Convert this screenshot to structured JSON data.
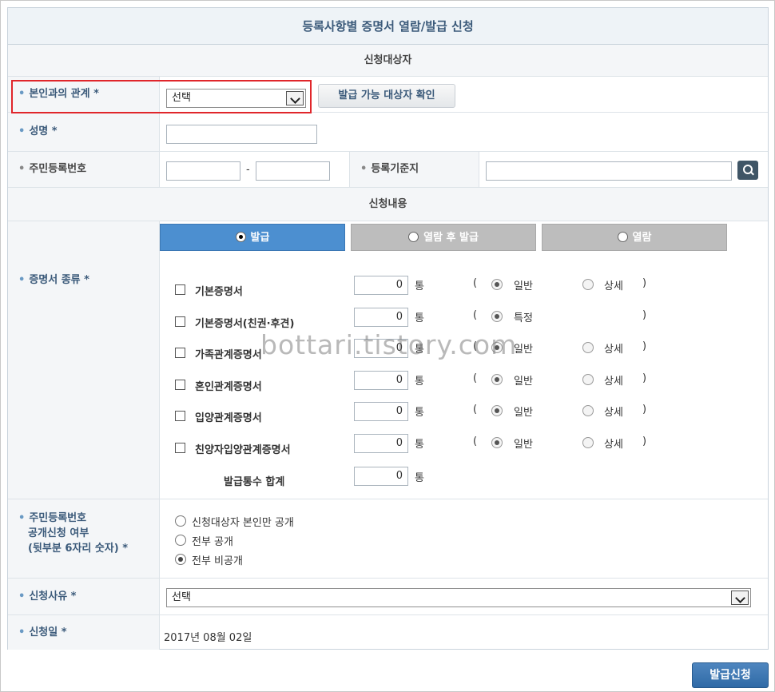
{
  "title": "등록사항별 증명서 열람/발급 신청",
  "sections": {
    "target": "신청대상자",
    "content": "신청내용"
  },
  "fields": {
    "relation_label": "본인과의 관계 *",
    "relation_value": "선택",
    "check_button": "발급 가능 대상자 확인",
    "name_label": "성명 *",
    "rrn_label": "주민등록번호",
    "rrn_sep": "-",
    "base_label": "등록기준지",
    "cert_type_label": "증명서 종류 *",
    "rrn_disclosure_label_1": "주민등록번호",
    "rrn_disclosure_label_2": "공개신청 여부",
    "rrn_disclosure_label_3": "(뒷부분 6자리 숫자) *",
    "reason_label": "신청사유 *",
    "reason_value": "선택",
    "date_label": "신청일 *",
    "date_value": "2017년 08월 02일"
  },
  "tabs": [
    {
      "label": "발급",
      "selected": true
    },
    {
      "label": "열람 후 발급",
      "selected": false
    },
    {
      "label": "열람",
      "selected": false
    }
  ],
  "certificates": [
    {
      "name": "기본증명서",
      "qty": "0",
      "unit": "통",
      "open": "(",
      "opt1": "일반",
      "opt2": "상세",
      "close": ")"
    },
    {
      "name": "기본증명서(친권·후견)",
      "qty": "0",
      "unit": "통",
      "open": "(",
      "opt1": "특정",
      "opt2": "",
      "close": ")"
    },
    {
      "name": "가족관계증명서",
      "qty": "0",
      "unit": "통",
      "open": "(",
      "opt1": "일반",
      "opt2": "상세",
      "close": ")"
    },
    {
      "name": "혼인관계증명서",
      "qty": "0",
      "unit": "통",
      "open": "(",
      "opt1": "일반",
      "opt2": "상세",
      "close": ")"
    },
    {
      "name": "입양관계증명서",
      "qty": "0",
      "unit": "통",
      "open": "(",
      "opt1": "일반",
      "opt2": "상세",
      "close": ")"
    },
    {
      "name": "친양자입양관계증명서",
      "qty": "0",
      "unit": "통",
      "open": "(",
      "opt1": "일반",
      "opt2": "상세",
      "close": ")"
    }
  ],
  "total": {
    "label": "발급통수 합계",
    "qty": "0",
    "unit": "통"
  },
  "disclosure_options": [
    {
      "label": "신청대상자 본인만 공개",
      "selected": false
    },
    {
      "label": "전부 공개",
      "selected": false
    },
    {
      "label": "전부 비공개",
      "selected": true
    }
  ],
  "watermark": "bottari.tistory.com",
  "submit": "발급신청",
  "colors": {
    "accent": "#4c8fd0",
    "highlight": "#e0262b",
    "label_blue": "#3b5a7a"
  }
}
